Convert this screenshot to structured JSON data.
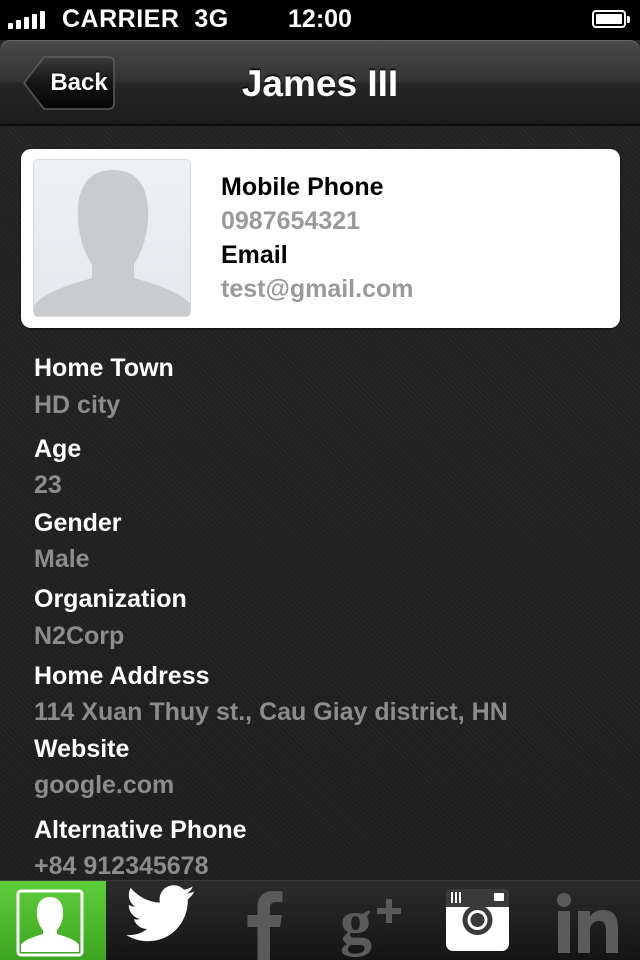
{
  "status_bar": {
    "carrier": "CARRIER",
    "network": "3G",
    "time": "12:00",
    "signal_bars": 5,
    "battery_level": 1.0
  },
  "nav": {
    "back_label": "Back",
    "title": "James III"
  },
  "card": {
    "avatar_icon": "person-silhouette-icon",
    "mobile_phone_label": "Mobile Phone",
    "mobile_phone_value": "0987654321",
    "email_label": "Email",
    "email_value": "test@gmail.com"
  },
  "details": [
    {
      "label": "Home Town",
      "value": "HD city"
    },
    {
      "label": "Age",
      "value": "23"
    },
    {
      "label": "Gender",
      "value": "Male"
    },
    {
      "label": "Organization",
      "value": "N2Corp"
    },
    {
      "label": "Home Address",
      "value": "114 Xuan Thuy st., Cau Giay district, HN"
    },
    {
      "label": "Website",
      "value": "google.com"
    },
    {
      "label": "Alternative Phone",
      "value": "+84 912345678"
    }
  ],
  "tabs": [
    {
      "name": "contact",
      "icon": "contact-icon",
      "active": true
    },
    {
      "name": "twitter",
      "icon": "twitter-icon",
      "active": false
    },
    {
      "name": "facebook",
      "icon": "facebook-icon",
      "active": false
    },
    {
      "name": "google-plus",
      "icon": "google-plus-icon",
      "active": false
    },
    {
      "name": "instagram",
      "icon": "instagram-icon",
      "active": false
    },
    {
      "name": "linkedin",
      "icon": "linkedin-icon",
      "active": false
    }
  ],
  "colors": {
    "active_tab": "#4dbb2a",
    "label_text": "#ffffff",
    "value_text": "#8c8c8c"
  }
}
